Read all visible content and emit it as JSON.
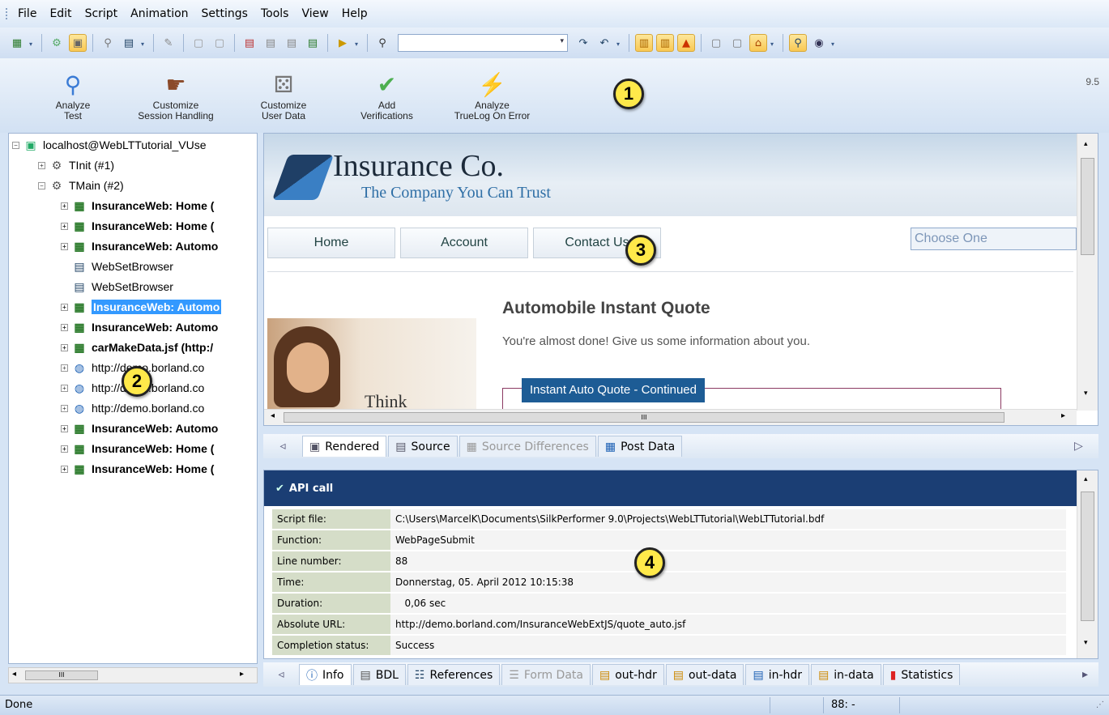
{
  "menu": [
    "File",
    "Edit",
    "Script",
    "Animation",
    "Settings",
    "Tools",
    "View",
    "Help"
  ],
  "toolbar": {
    "search_value": ""
  },
  "workflow": [
    {
      "label1": "Analyze",
      "label2": "Test",
      "icon": "magnifier-icon"
    },
    {
      "label1": "Customize",
      "label2": "Session Handling",
      "icon": "hand-icon"
    },
    {
      "label1": "Customize",
      "label2": "User Data",
      "icon": "dice-icon"
    },
    {
      "label1": "Add",
      "label2": "Verifications",
      "icon": "checkmark-icon"
    },
    {
      "label1": "Analyze",
      "label2": "TrueLog On Error",
      "icon": "lightning-icon"
    }
  ],
  "version": "9.5",
  "callouts": [
    "1",
    "2",
    "3",
    "4"
  ],
  "tree": {
    "root": "localhost@WebLTTutorial_VUse",
    "items": [
      "TInit (#1)",
      "TMain (#2)",
      "InsuranceWeb: Home (",
      "InsuranceWeb: Home (",
      "InsuranceWeb: Automo",
      "WebSetBrowser",
      "WebSetBrowser",
      "InsuranceWeb: Automo",
      "InsuranceWeb: Automo",
      "carMakeData.jsf (http:/",
      "http://demo.borland.co",
      "http://demo.borland.co",
      "http://demo.borland.co",
      "InsuranceWeb: Automo",
      "InsuranceWeb: Home (",
      "InsuranceWeb: Home ("
    ]
  },
  "page": {
    "company": "Insurance Co.",
    "tagline": "The Company You Can Trust",
    "nav": [
      "Home",
      "Account",
      "Contact Us"
    ],
    "choose": "Choose One",
    "heading": "Automobile Instant Quote",
    "subtext": "You're almost done! Give us some information about you.",
    "form_legend": "Instant Auto Quote - Continued",
    "image_text": "Think"
  },
  "tabs_top": [
    "Rendered",
    "Source",
    "Source Differences",
    "Post Data"
  ],
  "api": {
    "title": "API call",
    "rows": [
      {
        "k": "Script file:",
        "v": "C:\\Users\\MarcelK\\Documents\\SilkPerformer 9.0\\Projects\\WebLTTutorial\\WebLTTutorial.bdf"
      },
      {
        "k": "Function:",
        "v": "WebPageSubmit"
      },
      {
        "k": "Line number:",
        "v": "88"
      },
      {
        "k": "Time:",
        "v": "Donnerstag, 05. April 2012 10:15:38"
      },
      {
        "k": "Duration:",
        "v": "   0,06 sec"
      },
      {
        "k": "Absolute URL:",
        "v": "http://demo.borland.com/InsuranceWebExtJS/quote_auto.jsf"
      },
      {
        "k": "Completion status:",
        "v": "Success"
      }
    ]
  },
  "tabs_bottom": [
    "Info",
    "BDL",
    "References",
    "Form Data",
    "out-hdr",
    "out-data",
    "in-hdr",
    "in-data",
    "Statistics"
  ],
  "status": {
    "text": "Done",
    "line": "88: -"
  },
  "scroll_mark": "III"
}
